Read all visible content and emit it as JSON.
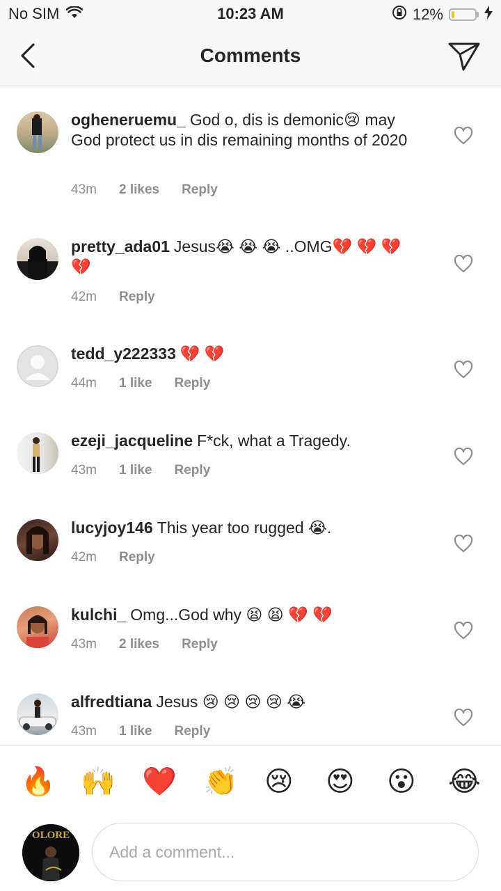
{
  "status_bar": {
    "carrier": "No SIM",
    "time": "10:23 AM",
    "battery_percent": "12%",
    "battery_level": 0.12,
    "icons": [
      "wifi-icon",
      "orientation-lock-icon",
      "battery-icon",
      "charging-bolt-icon"
    ]
  },
  "nav": {
    "title": "Comments",
    "back_icon": "chevron-left-icon",
    "send_icon": "paper-plane-icon"
  },
  "comments": [
    {
      "username": "ogheneruemu_",
      "text": "God o, dis is demonic😢 may God protect us in dis remaining months of 2020",
      "time": "43m",
      "likes": "2 likes",
      "reply": "Reply"
    },
    {
      "username": "pretty_ada01",
      "text": "Jesus😭 😭 😭 ..OMG💔 💔 💔 💔",
      "time": "42m",
      "likes": "",
      "reply": "Reply"
    },
    {
      "username": "tedd_y222333",
      "text": "💔 💔",
      "time": "44m",
      "likes": "1 like",
      "reply": "Reply"
    },
    {
      "username": "ezeji_jacqueline",
      "text": "F*ck, what a Tragedy.",
      "time": "43m",
      "likes": "1 like",
      "reply": "Reply"
    },
    {
      "username": "lucyjoy146",
      "text": "This year too rugged 😭.",
      "time": "42m",
      "likes": "",
      "reply": "Reply"
    },
    {
      "username": "kulchi_",
      "text": "Omg...God why 😫 😫 💔 💔",
      "time": "43m",
      "likes": "2 likes",
      "reply": "Reply"
    },
    {
      "username": "alfredtiana",
      "text": "Jesus 😢 😢 😢 😢 😭",
      "time": "43m",
      "likes": "1 like",
      "reply": "Reply"
    }
  ],
  "emoji_bar": [
    "🔥",
    "🙌",
    "❤️",
    "👏",
    "😢",
    "😍",
    "😮",
    "😂"
  ],
  "composer": {
    "avatar_text": "OLORE",
    "placeholder": "Add a comment..."
  },
  "colors": {
    "text": "#262626",
    "secondary": "#8e8e8e",
    "bar_bg": "#f8f8f8",
    "battery_fill": "#f0c419"
  }
}
